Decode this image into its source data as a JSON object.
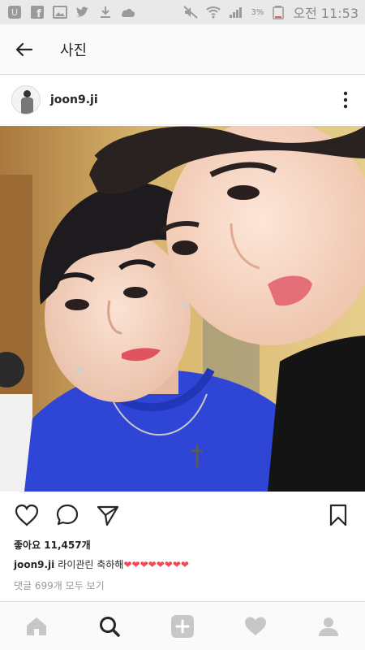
{
  "status_bar": {
    "left_icons": [
      "u-plus-icon",
      "facebook-icon",
      "gallery-icon",
      "twitter-icon",
      "download-icon",
      "cloud-icon"
    ],
    "battery_percent": "3%",
    "time": "오전 11:53"
  },
  "app_bar": {
    "title": "사진"
  },
  "post": {
    "username": "joon9.ji",
    "likes_text": "좋아요 11,457개",
    "caption_user": "joon9.ji",
    "caption_text": "라이관린 축하해❤❤❤❤❤❤❤❤",
    "comments_link": "댓글 699개 모두 보기"
  },
  "colors": {
    "accent": "#262626",
    "heart": "#ed4956",
    "muted": "#999999"
  },
  "icons": {
    "actions": [
      "heart-icon",
      "comment-icon",
      "share-icon",
      "bookmark-icon"
    ],
    "nav": [
      "home-icon",
      "search-icon",
      "add-icon",
      "activity-heart-icon",
      "profile-icon"
    ]
  }
}
